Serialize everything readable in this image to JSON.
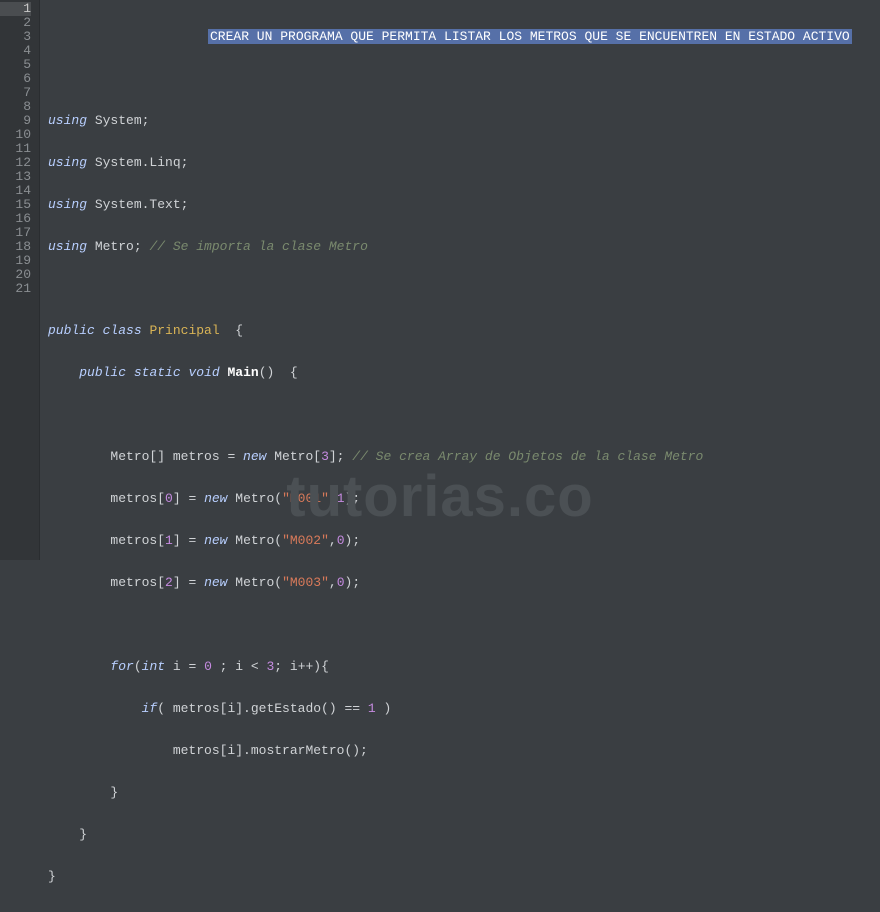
{
  "watermark": "tutorias.co",
  "gutter": {
    "start": 1,
    "end": 21,
    "active": 1
  },
  "code": {
    "line1_selection": "CREAR UN PROGRAMA QUE PERMITA LISTAR LOS METROS QUE SE ENCUENTREN EN ESTADO ACTIVO",
    "l3_kw": "using",
    "l3_txt": " System;",
    "l4_kw": "using",
    "l4_txt": " System.Linq;",
    "l5_kw": "using",
    "l5_txt": " System.Text;",
    "l6_kw": "using",
    "l6_txt": " Metro; ",
    "l6_cmt": "// Se importa la clase Metro",
    "l8_kw1": "public",
    "l8_kw2": "class",
    "l8_cls": "Principal",
    "l8_brace": "  {",
    "l9_kw1": "public",
    "l9_kw2": "static",
    "l9_type": "void",
    "l9_fn": "Main",
    "l9_rest": "()  {",
    "l11_a": "Metro[] metros = ",
    "l11_kw": "new",
    "l11_b": " Metro[",
    "l11_n": "3",
    "l11_c": "]; ",
    "l11_cmt": "// Se crea Array de Objetos de la clase Metro",
    "l12_a": "metros[",
    "l12_n1": "0",
    "l12_b": "] = ",
    "l12_kw": "new",
    "l12_c": " Metro(",
    "l12_s": "\"M001\"",
    "l12_d": ",",
    "l12_n2": "1",
    "l12_e": ");",
    "l13_a": "metros[",
    "l13_n1": "1",
    "l13_b": "] = ",
    "l13_kw": "new",
    "l13_c": " Metro(",
    "l13_s": "\"M002\"",
    "l13_d": ",",
    "l13_n2": "0",
    "l13_e": ");",
    "l14_a": "metros[",
    "l14_n1": "2",
    "l14_b": "] = ",
    "l14_kw": "new",
    "l14_c": " Metro(",
    "l14_s": "\"M003\"",
    "l14_d": ",",
    "l14_n2": "0",
    "l14_e": ");",
    "l16_kw1": "for",
    "l16_a": "(",
    "l16_type": "int",
    "l16_b": " i = ",
    "l16_n1": "0",
    "l16_c": " ; i < ",
    "l16_n2": "3",
    "l16_d": "; i++){",
    "l17_kw": "if",
    "l17_a": "( metros[i].getEstado() == ",
    "l17_n": "1",
    "l17_b": " )",
    "l18": "metros[i].mostrarMetro();",
    "l19": "}",
    "l20": "}",
    "l21": "}"
  }
}
